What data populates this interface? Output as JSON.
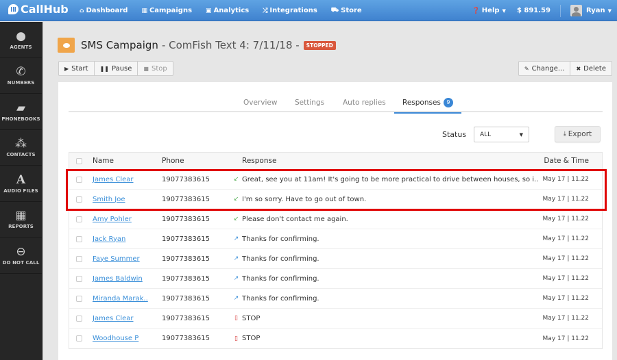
{
  "topbar": {
    "brand": "CallHub",
    "nav": [
      {
        "icon": "home-icon",
        "glyph": "⌂",
        "label": "Dashboard"
      },
      {
        "icon": "grid-icon",
        "glyph": "▦",
        "label": "Campaigns"
      },
      {
        "icon": "chart-icon",
        "glyph": "▣",
        "label": "Analytics"
      },
      {
        "icon": "shuffle-icon",
        "glyph": "⤮",
        "label": "Integrations"
      },
      {
        "icon": "cart-icon",
        "glyph": "⛟",
        "label": "Store"
      }
    ],
    "help_label": "Help",
    "balance": "$ 891.59",
    "user_name": "Ryan"
  },
  "sidebar": {
    "items": [
      {
        "icon": "agent-icon",
        "glyph": "●",
        "label": "AGENTS"
      },
      {
        "icon": "phone-icon",
        "glyph": "✆",
        "label": "NUMBERS"
      },
      {
        "icon": "book-icon",
        "glyph": "▰",
        "label": "PHONEBOOKS"
      },
      {
        "icon": "group-icon",
        "glyph": "⁂",
        "label": "CONTACTS"
      },
      {
        "icon": "font-icon",
        "glyph": "A",
        "label": "AUDIO FILES"
      },
      {
        "icon": "table-icon",
        "glyph": "▦",
        "label": "REPORTS"
      },
      {
        "icon": "minus-circle-icon",
        "glyph": "⊖",
        "label": "DO NOT CALL"
      }
    ]
  },
  "header": {
    "title": "SMS Campaign",
    "subtitle": "- ComFish Text 4: 7/11/18 -",
    "status": "STOPPED"
  },
  "actions": {
    "start": "Start",
    "pause": "Pause",
    "stop": "Stop",
    "change": "Change...",
    "delete": "Delete"
  },
  "tabs": [
    {
      "label": "Overview"
    },
    {
      "label": "Settings"
    },
    {
      "label": "Auto replies"
    },
    {
      "label": "Responses",
      "count": "9",
      "active": true
    }
  ],
  "filter": {
    "status_label": "Status",
    "status_value": "ALL",
    "export_label": "Export"
  },
  "table": {
    "columns": [
      "Name",
      "Phone",
      "Response",
      "Date & Time"
    ],
    "rows": [
      {
        "name": "James Clear",
        "phone": "19077383615",
        "direction": "incoming",
        "response": "Great, see you at 11am! It's going to be more practical to drive between houses, so i..",
        "datetime": "May 17 | 11.22"
      },
      {
        "name": "Smith Joe",
        "phone": "19077383615",
        "direction": "incoming",
        "response": "I'm so sorry. Have to go out of town.",
        "datetime": "May 17 | 11.22"
      },
      {
        "name": "Amy Pohler",
        "phone": "19077383615",
        "direction": "incoming",
        "response": "Please don't contact me again.",
        "datetime": "May 17 | 11.22"
      },
      {
        "name": "Jack Ryan",
        "phone": "19077383615",
        "direction": "outgoing",
        "response": "Thanks for confirming.",
        "datetime": "May 17 | 11.22"
      },
      {
        "name": "Faye Summer",
        "phone": "19077383615",
        "direction": "outgoing",
        "response": "Thanks for confirming.",
        "datetime": "May 17 | 11.22"
      },
      {
        "name": "James Baldwin",
        "phone": "19077383615",
        "direction": "outgoing",
        "response": "Thanks for confirming.",
        "datetime": "May 17 | 11.22"
      },
      {
        "name": "Miranda Marak..",
        "phone": "19077383615",
        "direction": "outgoing",
        "response": "Thanks for confirming.",
        "datetime": "May 17 | 11.22"
      },
      {
        "name": "James Clear",
        "phone": "19077383615",
        "direction": "stop",
        "response": "STOP",
        "datetime": "May 17 | 11.22"
      },
      {
        "name": "Woodhouse P",
        "phone": "19077383615",
        "direction": "stop",
        "response": "STOP",
        "datetime": "May 17 | 11.22"
      }
    ]
  },
  "colors": {
    "topbar": "#4a90dc",
    "sidebar": "#262626",
    "accent": "#3a87d6",
    "stopped": "#d9573c",
    "sms_badge": "#f0a54a",
    "highlight": "#e00000"
  }
}
